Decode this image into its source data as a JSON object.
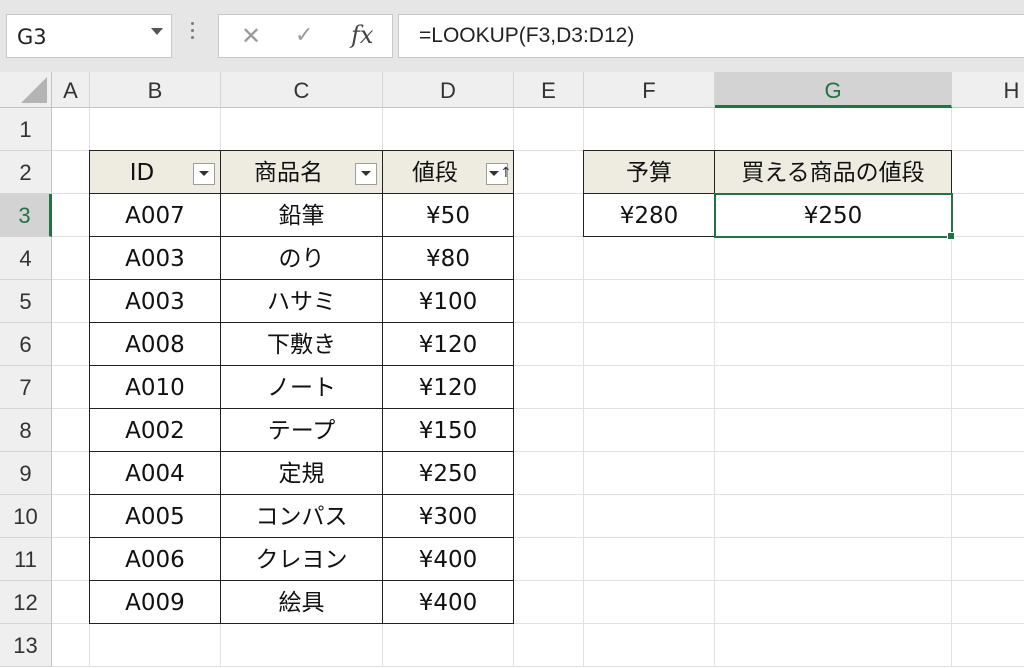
{
  "name_box": "G3",
  "formula": "=LOOKUP(F3,D3:D12)",
  "icons": {
    "cancel": "✕",
    "enter": "✓",
    "function": "fx"
  },
  "columns": [
    "A",
    "B",
    "C",
    "D",
    "E",
    "F",
    "G",
    "H"
  ],
  "rows": [
    "1",
    "2",
    "3",
    "4",
    "5",
    "6",
    "7",
    "8",
    "9",
    "10",
    "11",
    "12",
    "13"
  ],
  "selected_cell": {
    "column": "G",
    "row": "3"
  },
  "table": {
    "headers": [
      "ID",
      "商品名",
      "値段"
    ],
    "rows": [
      [
        "A007",
        "鉛筆",
        "¥50"
      ],
      [
        "A003",
        "のり",
        "¥80"
      ],
      [
        "A003",
        "ハサミ",
        "¥100"
      ],
      [
        "A008",
        "下敷き",
        "¥120"
      ],
      [
        "A010",
        "ノート",
        "¥120"
      ],
      [
        "A002",
        "テープ",
        "¥150"
      ],
      [
        "A004",
        "定規",
        "¥250"
      ],
      [
        "A005",
        "コンパス",
        "¥300"
      ],
      [
        "A006",
        "クレヨン",
        "¥400"
      ],
      [
        "A009",
        "絵具",
        "¥400"
      ]
    ]
  },
  "lookup": {
    "headers": [
      "予算",
      "買える商品の値段"
    ],
    "values": [
      "¥280",
      "¥250"
    ]
  },
  "colors": {
    "header_fill": "#eeece1",
    "selection": "#217346"
  }
}
